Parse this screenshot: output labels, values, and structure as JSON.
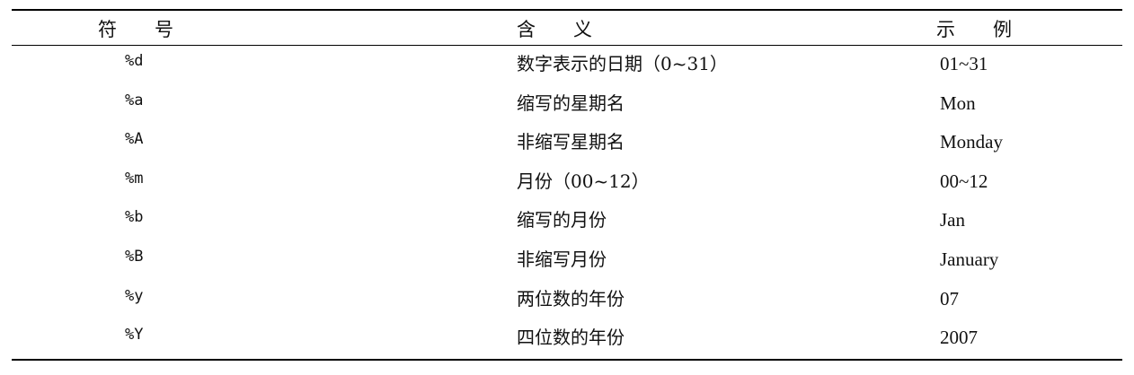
{
  "table": {
    "headers": {
      "symbol": "符　　号",
      "meaning": "含　　义",
      "example": "示　　例"
    },
    "rows": [
      {
        "symbol": "%d",
        "meaning": "数字表示的日期（0~31）",
        "example": "01~31"
      },
      {
        "symbol": "%a",
        "meaning": "缩写的星期名",
        "example": "Mon"
      },
      {
        "symbol": "%A",
        "meaning": "非缩写星期名",
        "example": "Monday"
      },
      {
        "symbol": "%m",
        "meaning": "月份（00~12）",
        "example": "00~12"
      },
      {
        "symbol": "%b",
        "meaning": "缩写的月份",
        "example": "Jan"
      },
      {
        "symbol": "%B",
        "meaning": "非缩写月份",
        "example": "January"
      },
      {
        "symbol": "%y",
        "meaning": "两位数的年份",
        "example": "07"
      },
      {
        "symbol": "%Y",
        "meaning": "四位数的年份",
        "example": "2007"
      }
    ]
  }
}
